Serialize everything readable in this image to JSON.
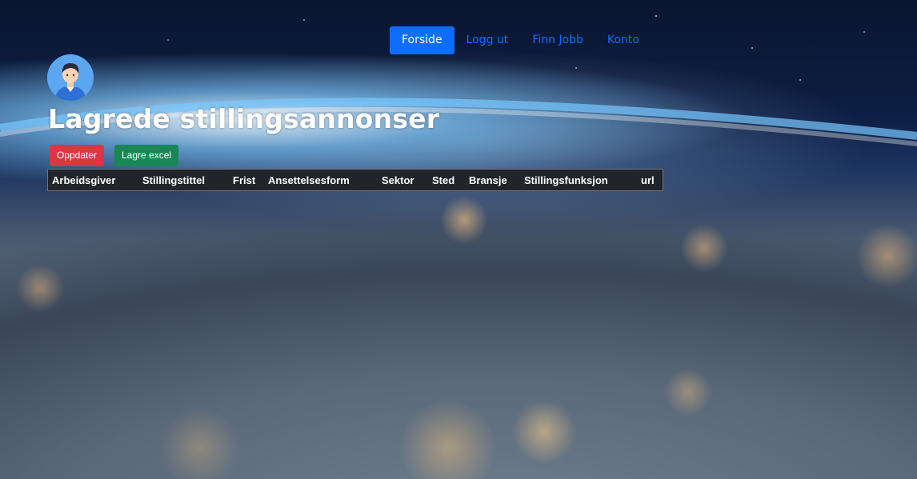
{
  "nav": {
    "items": [
      {
        "label": "Forside",
        "active": true
      },
      {
        "label": "Logg ut",
        "active": false
      },
      {
        "label": "Finn Jobb",
        "active": false
      },
      {
        "label": "Konto",
        "active": false
      }
    ]
  },
  "page": {
    "title": "Lagrede stillingsannonser"
  },
  "actions": {
    "update_label": "Oppdater",
    "save_excel_label": "Lagre excel"
  },
  "table": {
    "columns": [
      "Arbeidsgiver",
      "Stillingstittel",
      "Frist",
      "Ansettelsesform",
      "Sektor",
      "Sted",
      "Bransje",
      "Stillingsfunksjon",
      "url"
    ],
    "rows": []
  },
  "colors": {
    "primary": "#0d6efd",
    "danger": "#dc3545",
    "success": "#198754",
    "table_dark": "#212529"
  },
  "icons": {
    "avatar": "user-avatar-icon"
  }
}
